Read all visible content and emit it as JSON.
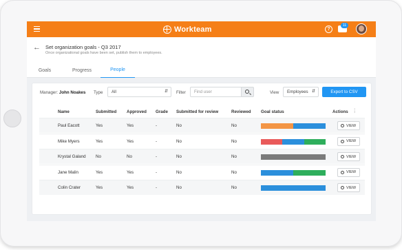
{
  "topbar": {
    "brand": "Workteam",
    "help_glyph": "?",
    "chat_badge": "11",
    "color": "#f57f17"
  },
  "header": {
    "title": "Set organization goals - Q3 2017",
    "subtitle": "Once organizational goals have been set, publish them to employees.",
    "tabs": [
      {
        "label": "Goals",
        "active": false
      },
      {
        "label": "Progress",
        "active": false
      },
      {
        "label": "People",
        "active": true
      }
    ]
  },
  "filters": {
    "manager_label": "Manager:",
    "manager_name": "John Noakes",
    "type_label": "Type",
    "type_value": "All",
    "filter_label": "Filter",
    "filter_placeholder": "Find user",
    "view_label": "View",
    "view_value": "Employees",
    "export_label": "Export to CSV"
  },
  "table": {
    "columns": [
      "Name",
      "Submitted",
      "Approved",
      "Grade",
      "Submitted for review",
      "Reviewed",
      "Goal status",
      "Actions"
    ],
    "view_label": "VIEW",
    "rows": [
      {
        "name": "Paul Eacott",
        "submitted": "Yes",
        "approved": "Yes",
        "grade": "-",
        "submitted_for_review": "No",
        "reviewed": "No",
        "goal_status": [
          {
            "color": "#f39545",
            "value": 0.5
          },
          {
            "color": "#2b8fdc",
            "value": 0.5
          }
        ]
      },
      {
        "name": "Mike Myers",
        "submitted": "Yes",
        "approved": "Yes",
        "grade": "-",
        "submitted_for_review": "No",
        "reviewed": "No",
        "goal_status": [
          {
            "color": "#e95a5a",
            "value": 0.33
          },
          {
            "color": "#2b8fdc",
            "value": 0.34
          },
          {
            "color": "#2eae5c",
            "value": 0.33
          }
        ]
      },
      {
        "name": "Krystal Galand",
        "submitted": "No",
        "approved": "No",
        "grade": "-",
        "submitted_for_review": "No",
        "reviewed": "No",
        "goal_status": [
          {
            "color": "#7b7b7b",
            "value": 1.0
          }
        ]
      },
      {
        "name": "Jane Malin",
        "submitted": "Yes",
        "approved": "Yes",
        "grade": "-",
        "submitted_for_review": "No",
        "reviewed": "No",
        "goal_status": [
          {
            "color": "#2b8fdc",
            "value": 0.5
          },
          {
            "color": "#2eae5c",
            "value": 0.5
          }
        ]
      },
      {
        "name": "Colin Crater",
        "submitted": "Yes",
        "approved": "Yes",
        "grade": "-",
        "submitted_for_review": "No",
        "reviewed": "No",
        "goal_status": [
          {
            "color": "#2b8fdc",
            "value": 1.0
          }
        ]
      }
    ]
  }
}
